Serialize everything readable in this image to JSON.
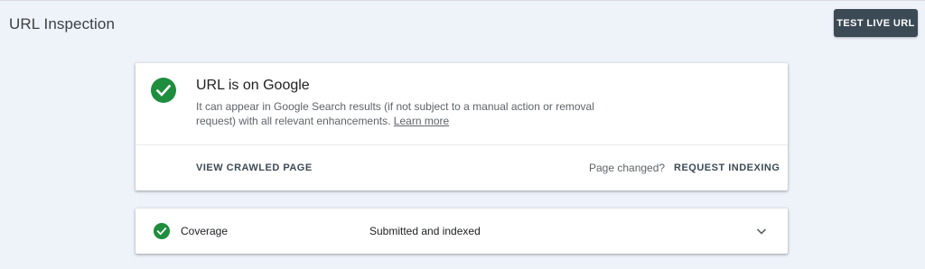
{
  "header": {
    "title": "URL Inspection",
    "test_live_label": "TEST LIVE URL"
  },
  "status_card": {
    "icon": "check-circle-icon",
    "title": "URL is on Google",
    "description": "It can appear in Google Search results (if not subject to a manual action or removal request) with all relevant enhancements.",
    "learn_more": "Learn more",
    "view_crawled_label": "VIEW CRAWLED PAGE",
    "page_changed_text": "Page changed?",
    "request_indexing_label": "REQUEST INDEXING"
  },
  "coverage": {
    "icon": "check-circle-icon",
    "label": "Coverage",
    "status": "Submitted and indexed",
    "expand_icon": "chevron-down-icon"
  },
  "colors": {
    "background": "#eef2f9",
    "success_green": "#1e8e3e",
    "primary_button": "#3c4a55",
    "card": "#ffffff"
  }
}
